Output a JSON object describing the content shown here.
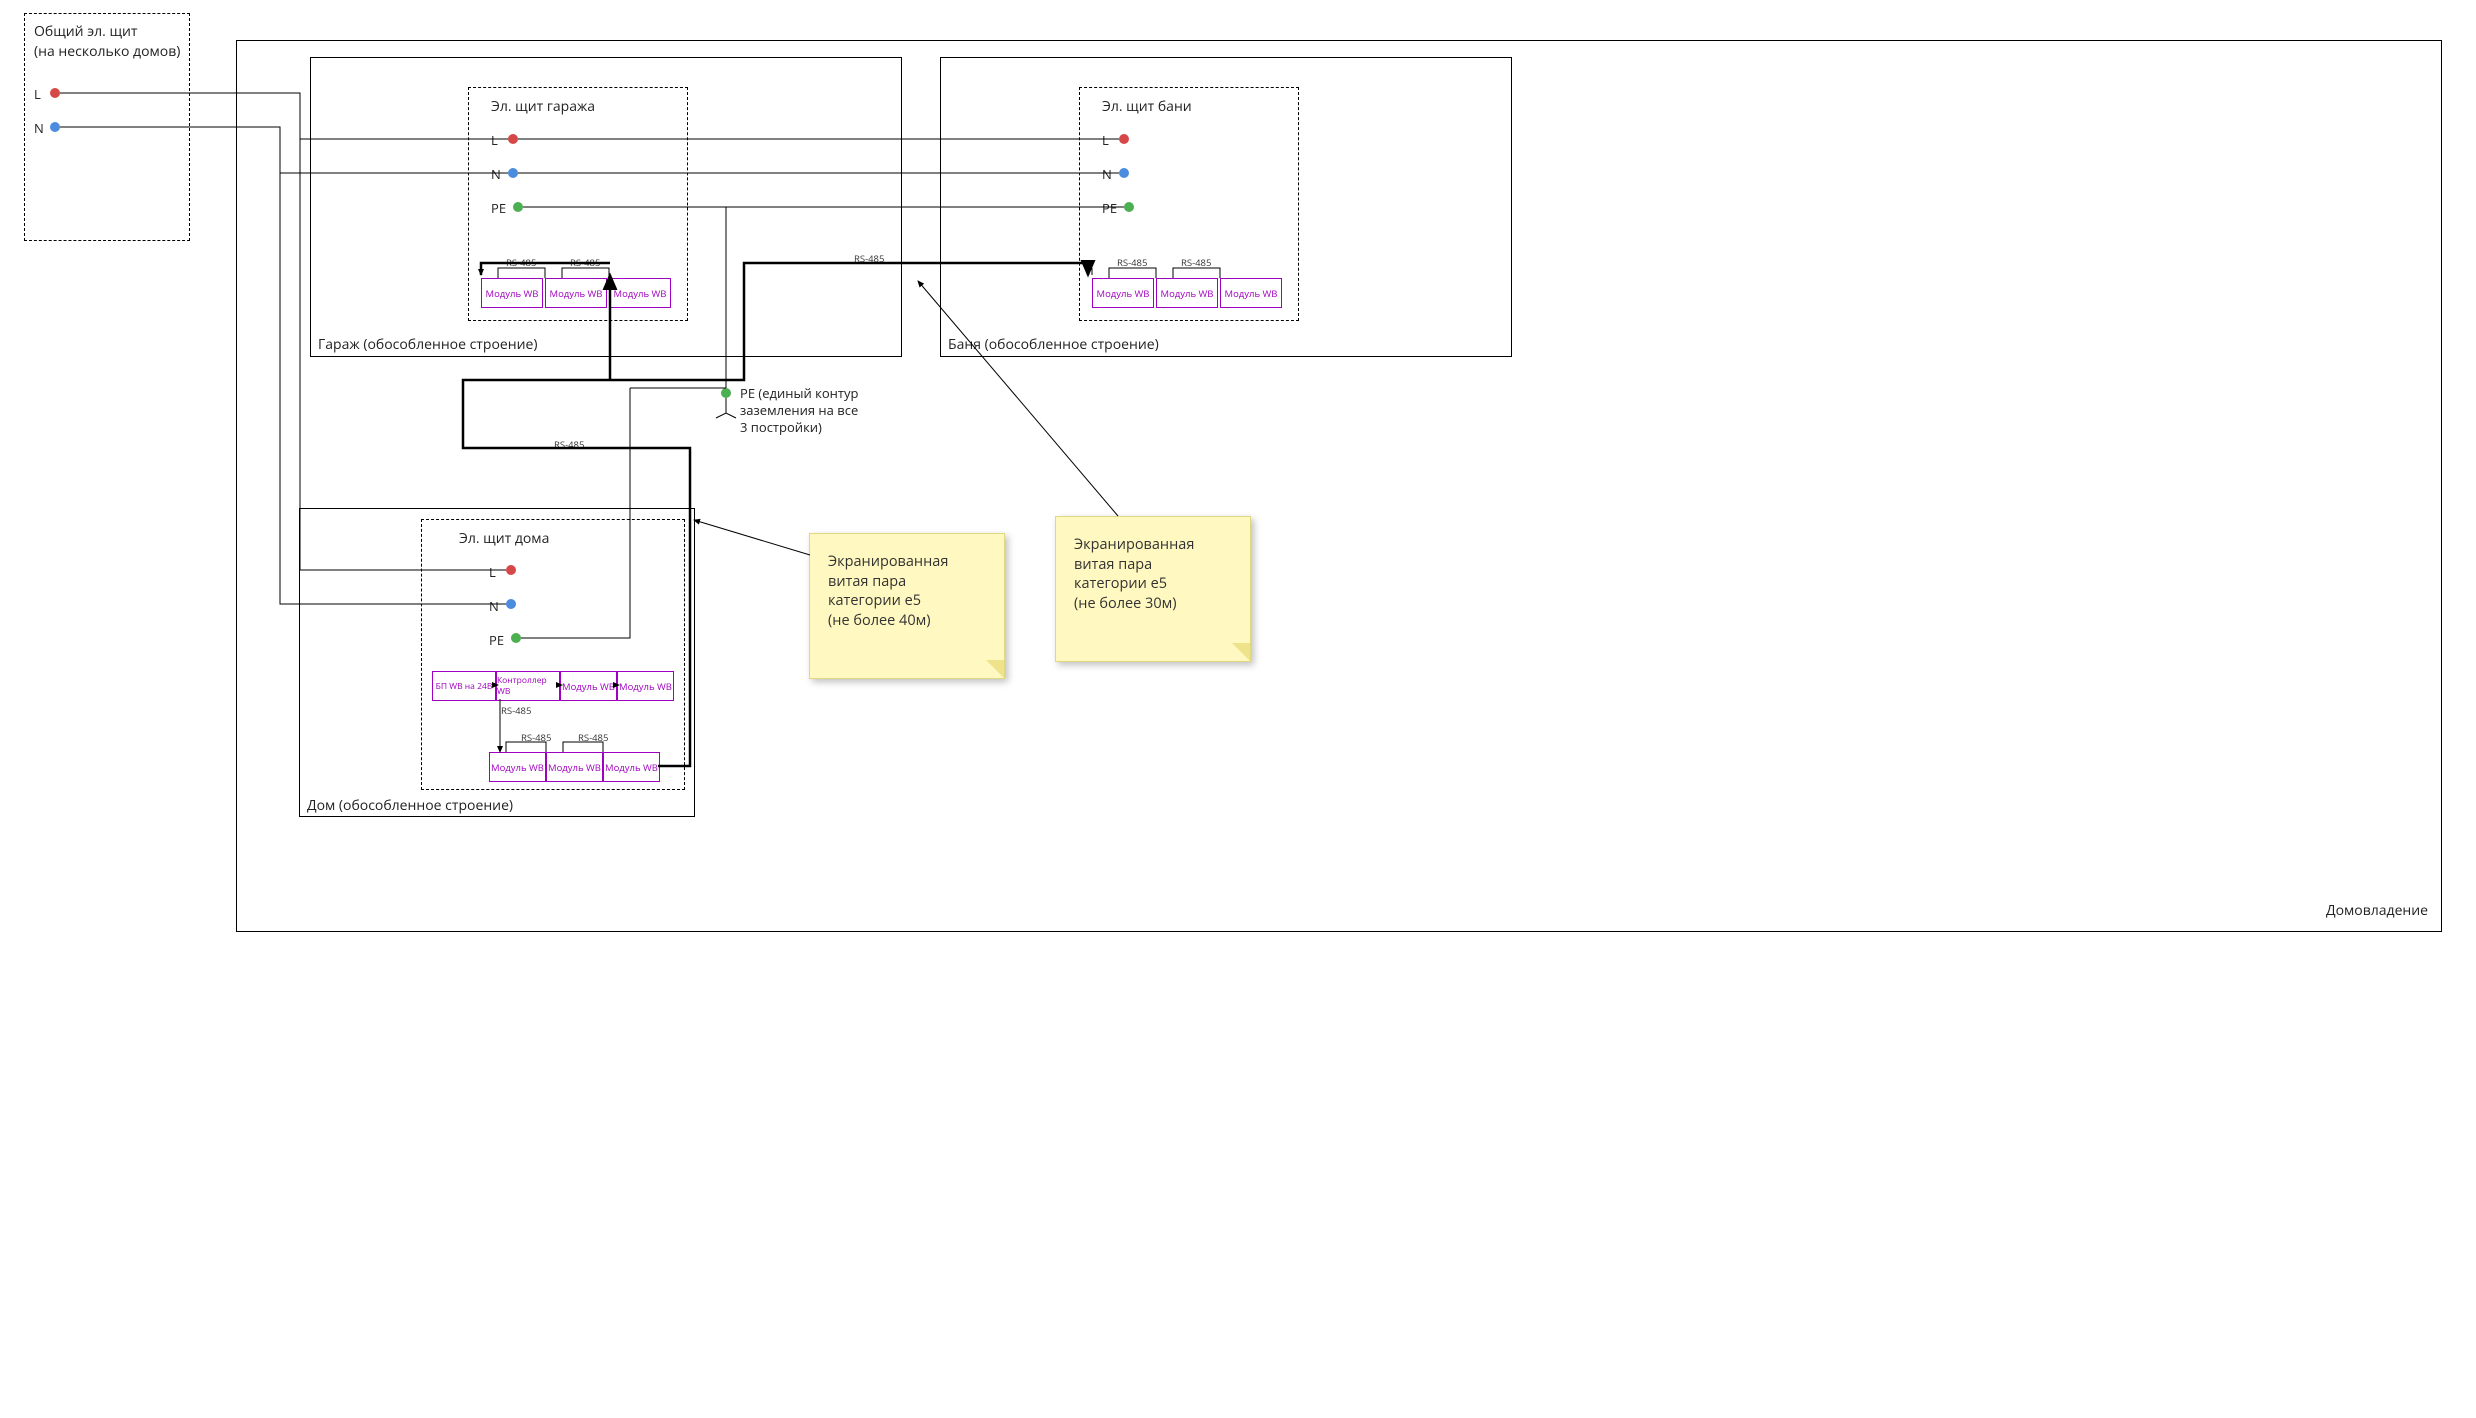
{
  "ownership": {
    "label": "Домовладение"
  },
  "mainPanel": {
    "title1": "Общий эл. щит",
    "title2": "(на несколько домов)",
    "L": "L",
    "N": "N"
  },
  "garage": {
    "buildingTitle": "Гараж (обособленное строение)",
    "panelTitle": "Эл. щит гаража",
    "L": "L",
    "N": "N",
    "PE": "PE",
    "modules": [
      "Модуль WB",
      "Модуль WB",
      "Модуль WB"
    ],
    "rs": "RS-485"
  },
  "bath": {
    "buildingTitle": "Баня (обособленное строение)",
    "panelTitle": "Эл. щит бани",
    "L": "L",
    "N": "N",
    "PE": "PE",
    "modules": [
      "Модуль WB",
      "Модуль WB",
      "Модуль WB"
    ],
    "rs": "RS-485"
  },
  "house": {
    "buildingTitle": "Дом (обособленное строение)",
    "panelTitle": "Эл. щит дома",
    "L": "L",
    "N": "N",
    "PE": "PE",
    "topModules": [
      "БП WB на 24В",
      "Контроллер WB",
      "Модуль WB",
      "Модуль WB"
    ],
    "bottomModules": [
      "Модуль WB",
      "Модуль WB",
      "Модуль WB"
    ],
    "rs": "RS-485"
  },
  "pe": {
    "line1": "PE (единый контур",
    "line2": "заземления на все",
    "line3": "3 постройки)"
  },
  "note1": {
    "text": "Экранированная\nвитая пара\nкатегории e5\n(не более 40м)"
  },
  "note2": {
    "text": "Экранированная\nвитая пара\nкатегории e5\n(не более 30м)"
  }
}
